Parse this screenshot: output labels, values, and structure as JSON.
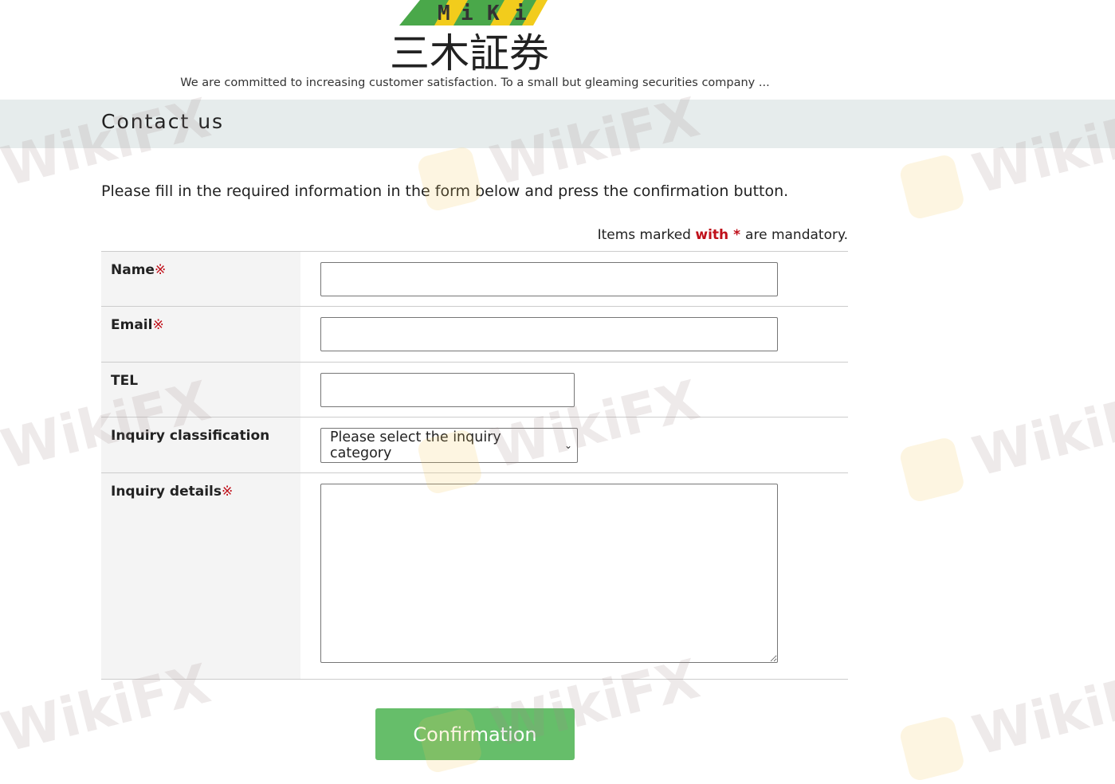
{
  "header": {
    "logo_letters": [
      "M",
      "i",
      "K",
      "i"
    ],
    "logo_kanji": "三木証券",
    "tagline": "We are committed to increasing customer satisfaction. To a small but gleaming securities company ...",
    "colors": {
      "green": "#4aa84a",
      "yellow": "#f2cc1c"
    }
  },
  "page_title": "Contact us",
  "intro": "Please fill in the required information in the form below and press the confirmation button.",
  "mandatory_note": {
    "prefix": "Items marked",
    "emphasis": "with",
    "star": "*",
    "suffix": "are mandatory."
  },
  "form": {
    "required_mark": "※",
    "fields": {
      "name_label": "Name",
      "name_value": "",
      "email_label": "Email",
      "email_value": "",
      "tel_label": "TEL",
      "tel_value": "",
      "inquiry_class_label": "Inquiry classification",
      "inquiry_class_selected": "Please select the inquiry category",
      "inquiry_details_label": "Inquiry details",
      "inquiry_details_value": ""
    }
  },
  "confirm_button": "Confirmation",
  "watermark_text": "WikiFX",
  "colors": {
    "accent_green": "#66be6a",
    "required_red": "#c0101a",
    "title_band": "#e6ecec"
  }
}
